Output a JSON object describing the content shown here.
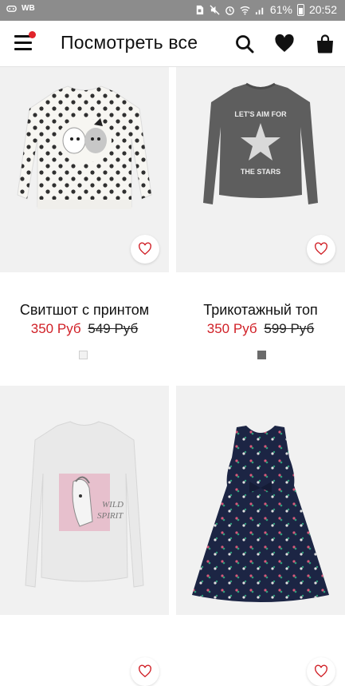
{
  "status_bar": {
    "carrier": "WB",
    "battery_percent": "61%",
    "time": "20:52"
  },
  "header": {
    "title": "Посмотреть все",
    "menu_icon": "hamburger-menu-icon",
    "search_icon": "search-icon",
    "favorites_icon": "heart-icon",
    "bag_icon": "shopping-bag-icon",
    "notification_dot_color": "#e0242b"
  },
  "products": [
    {
      "name": "Свитшот с принтом",
      "price": "350 Руб",
      "old_price": "549 Руб",
      "swatch_color": "#f2f2f2",
      "image": "white polka-dot sweatshirt with puppy and kitten print"
    },
    {
      "name": "Трикотажный топ",
      "price": "350 Руб",
      "old_price": "599 Руб",
      "swatch_color": "#6b6b6b",
      "image": "grey long-sleeve top with star print",
      "image_text": [
        "LET'S AIM FOR",
        "THE STARS"
      ]
    },
    {
      "name": "",
      "price": "",
      "old_price": "",
      "image": "light grey long-sleeve top with horse print",
      "image_text": [
        "WILD",
        "SPIRIT"
      ]
    },
    {
      "name": "",
      "price": "",
      "old_price": "",
      "image": "navy sleeveless floral dress"
    }
  ],
  "colors": {
    "sale_price": "#d01f26",
    "image_bg": "#f1f1f1"
  }
}
